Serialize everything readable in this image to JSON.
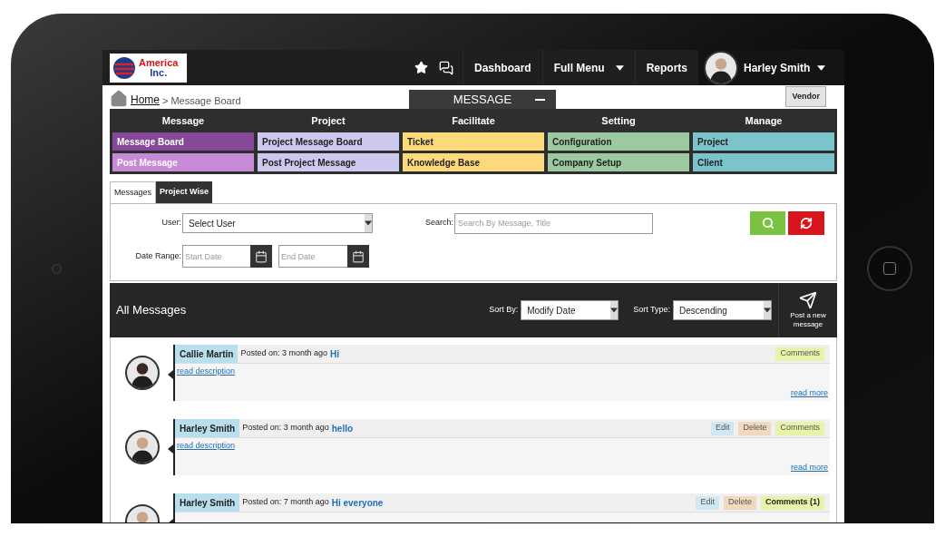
{
  "logo": {
    "line1": "America",
    "line2": "Inc."
  },
  "nav": {
    "items": [
      {
        "label": "Dashboard",
        "caret": false
      },
      {
        "label": "Full Menu",
        "caret": true
      },
      {
        "label": "Reports",
        "caret": false
      }
    ],
    "user": "Harley Smith"
  },
  "breadcrumb": {
    "home": "Home",
    "separator": ">",
    "current": "Message Board"
  },
  "panel_tab": {
    "label": "MESSAGE"
  },
  "vendor_button": "Vendor",
  "menu": [
    {
      "heading": "Message",
      "items": [
        {
          "label": "Message Board",
          "color": "#86499a"
        },
        {
          "label": "Post Message",
          "color": "#c68ad6"
        }
      ]
    },
    {
      "heading": "Project",
      "items": [
        {
          "label": "Project Message Board",
          "color": "#cdc8ee"
        },
        {
          "label": "Post Project Message",
          "color": "#cdc8ee"
        }
      ]
    },
    {
      "heading": "Facilitate",
      "items": [
        {
          "label": "Ticket",
          "color": "#fcd97a"
        },
        {
          "label": "Knowledge Base",
          "color": "#fcd97a"
        }
      ]
    },
    {
      "heading": "Setting",
      "items": [
        {
          "label": "Configuration",
          "color": "#9cc9a0"
        },
        {
          "label": "Company Setup",
          "color": "#9cc9a0"
        }
      ]
    },
    {
      "heading": "Manage",
      "items": [
        {
          "label": "Project",
          "color": "#7cc4cc"
        },
        {
          "label": "Client",
          "color": "#7cc4cc"
        }
      ]
    }
  ],
  "tabs": [
    {
      "label": "Messages",
      "selected": true
    },
    {
      "label": "Project Wise",
      "selected": false
    }
  ],
  "filters": {
    "user_label": "User:",
    "user_value": "Select User",
    "search_label": "Search:",
    "search_placeholder": "Search By Message, Title",
    "date_label": "Date Range:",
    "start_placeholder": "Start Date",
    "end_placeholder": "End Date"
  },
  "list_header": {
    "title": "All Messages",
    "sort_by_label": "Sort By:",
    "sort_by_value": "Modify Date",
    "sort_type_label": "Sort Type:",
    "sort_type_value": "Descending",
    "post_new": "Post a new message"
  },
  "messages": [
    {
      "author": "Callie Martin",
      "posted": "Posted on: 3 month ago",
      "title": "Hi",
      "buttons": [
        {
          "kind": "comments",
          "label": "Comments"
        }
      ],
      "description": "read description",
      "read_more": "read more"
    },
    {
      "author": "Harley Smith",
      "posted": "Posted on: 3 month ago",
      "title": "hello",
      "buttons": [
        {
          "kind": "edit",
          "label": "Edit"
        },
        {
          "kind": "delete",
          "label": "Delete"
        },
        {
          "kind": "comments",
          "label": "Comments"
        }
      ],
      "description": "read description",
      "read_more": "read more"
    },
    {
      "author": "Harley Smith",
      "posted": "Posted on: 7 month ago",
      "title": "Hi everyone",
      "buttons": [
        {
          "kind": "edit",
          "label": "Edit"
        },
        {
          "kind": "delete",
          "label": "Delete"
        },
        {
          "kind": "comments_count",
          "label": "Comments (1)"
        }
      ]
    }
  ]
}
